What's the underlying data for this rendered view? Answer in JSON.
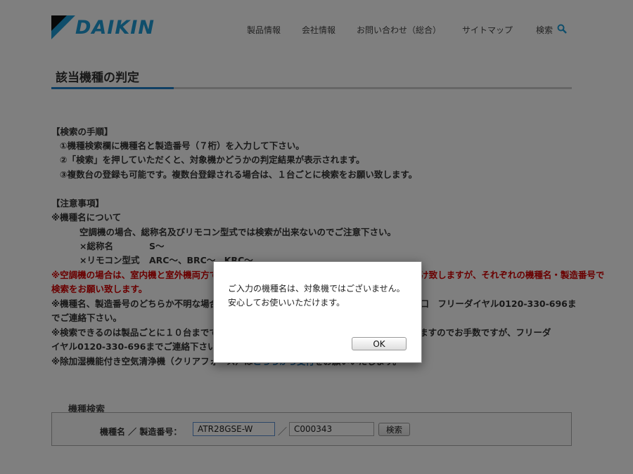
{
  "header": {
    "logo_text": "DAIKIN",
    "brand_color": "#1e9cd7",
    "nav": [
      "製品情報",
      "会社情報",
      "お問い合わせ（総合）",
      "サイトマップ"
    ],
    "search_label": "検索"
  },
  "page": {
    "title": "該当機種の判定",
    "accent_color": "#1e7fc6"
  },
  "content": {
    "procedure_heading": "【検索の手順】",
    "procedure_steps": [
      "①機種検索欄に機種名と製造番号（７桁）を入力して下さい。",
      "②「検索」を押していただくと、対象機かどうかの判定結果が表示されます。",
      "③複数台の登録も可能です。複数台登録される場合は、１台ごとに検索をお願い致します。"
    ],
    "notes_heading": "【注意事項】",
    "model_note_heading": "※機種名について",
    "model_note_text": "空調機の場合、総称名及びリモコン型式では検索が出来ないのでご注意下さい。",
    "generic_name_label": "×総称名",
    "generic_name_value": "S〜",
    "remote_label": "×リモコン型式",
    "remote_value": "ARC〜、BRC〜、KRC〜",
    "red_note_line1": "※空調機の場合は、室内機と室外機両方で対象かどうかがご判定されますので、お手数をおかけ致しますが、それぞれの機種名・製造番号で",
    "red_note_line2": "検索をお願い致します。",
    "unknown_note_line1": "※機種名、製造番号のどちらか不明な場合は、お手数ですが本ページ最下段のお問い合わせ窓口　フリーダイヤル0120-330-696ま",
    "unknown_note_line2": "でご連絡下さい。",
    "limit_note_line1": "※検索できるのは製品ごとに１０台までです。１１台以上ご入力いただいた場合はお断りとしますのでお手数ですが、フリーダ",
    "limit_note_line2": "イヤル0120-330-696までご連絡下さい。",
    "purifier_note_prefix": "※除加湿機能付き空気清浄機（クリアフォース）は",
    "purifier_note_link": "こちらから受付",
    "purifier_note_suffix": "をお願いいたします。",
    "red_color": "#d40000"
  },
  "form": {
    "heading": "機種検索",
    "label": "機種名 ／ 製造番号：",
    "model_value": "ATR28GSE-W",
    "slash": "／",
    "serial_value": "C000343",
    "search_button": "検索"
  },
  "dialog": {
    "message_line1": "ご入力の機種名は、対象機ではございません。",
    "message_line2": "安心してお使いいただけます。",
    "ok_label": "OK"
  }
}
